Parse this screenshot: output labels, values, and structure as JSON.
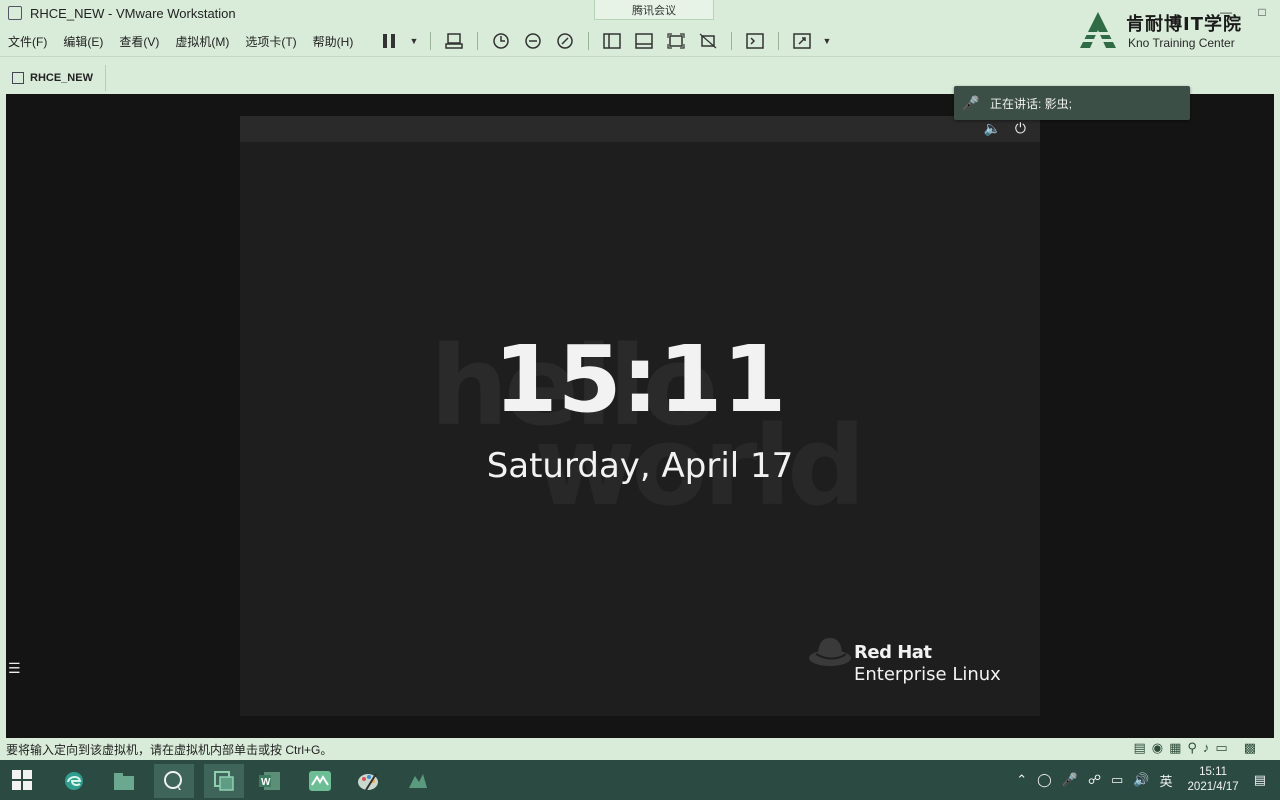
{
  "window": {
    "title": "RHCE_NEW - VMware Workstation",
    "meeting_tab": "腾讯会议",
    "controls": [
      "minimize-icon",
      "maximize-icon",
      "close-icon"
    ]
  },
  "menu": {
    "items": [
      "文件(F)",
      "编辑(E)",
      "查看(V)",
      "虚拟机(M)",
      "选项卡(T)",
      "帮助(H)"
    ]
  },
  "toolbar": {
    "icons": [
      "pause-icon",
      "send-ctrl-alt-del-icon",
      "snapshot-icon",
      "revert-snapshot-icon",
      "snapshot-manager-icon",
      "library-icon",
      "console-view-icon",
      "fullscreen-icon",
      "unity-icon",
      "terminal-icon",
      "stretch-icon"
    ]
  },
  "brand": {
    "name_cn": "肯耐博IT学院",
    "name_en": "Kno Training Center"
  },
  "vm_tab": {
    "label": "RHCE_NEW"
  },
  "meeting": {
    "speaking_label": "正在讲话: 影虫;"
  },
  "guest": {
    "time": "15:11",
    "date": "Saturday, April 17",
    "watermark_line1": "hello",
    "watermark_line2": "world",
    "vendor": "Red Hat",
    "product": "Enterprise Linux",
    "icons": [
      "volume-muted-icon",
      "power-icon"
    ]
  },
  "status": {
    "hint": "要将输入定向到该虚拟机，请在虚拟机内部单击或按 Ctrl+G。"
  },
  "taskbar": {
    "apps": [
      "edge-icon",
      "file-explorer-icon",
      "search-icon",
      "vmware-icon",
      "word-icon",
      "meeting-icon",
      "paint-icon",
      "network-app-icon"
    ],
    "tray_lang": "英",
    "time": "15:11",
    "date": "2021/4/17"
  },
  "colors": {
    "window_chrome": "#d9ecd9",
    "taskbar": "#2b4a42",
    "guest_bg": "#1e1e1e",
    "clock_text": "#f2f2f2"
  }
}
